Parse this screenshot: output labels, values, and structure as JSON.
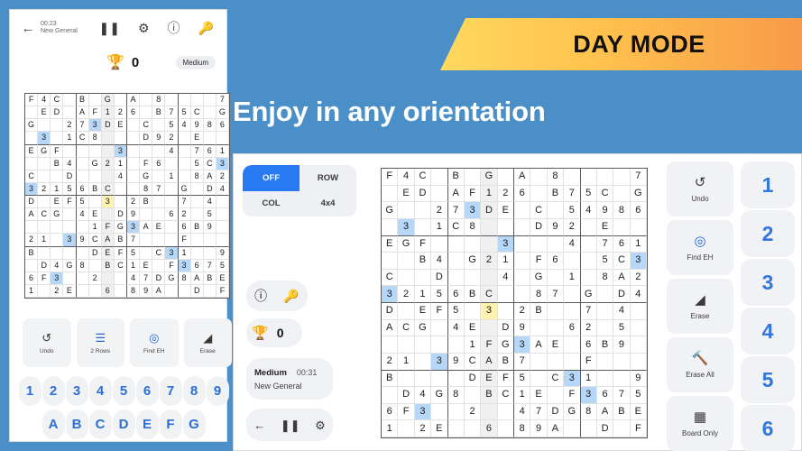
{
  "banner": {
    "label": "DAY MODE"
  },
  "headline": {
    "text": "Enjoy in any orientation"
  },
  "phone": {
    "header": {
      "back_icon": "arrow-left-icon",
      "time": "00:23",
      "puzzle_name": "New General",
      "pause_icon": "pause-icon",
      "settings_icon": "gear-icon",
      "info_icon": "info-icon",
      "key_icon": "key-icon"
    },
    "score": {
      "trophy_icon": "trophy-icon",
      "points": "0",
      "difficulty": "Medium"
    },
    "actions": [
      {
        "icon": "undo-icon",
        "glyph": "↺",
        "label": "Undo",
        "accent": false
      },
      {
        "icon": "rows-icon",
        "glyph": "☰",
        "label": "2 Rows",
        "accent": true
      },
      {
        "icon": "find-eh-icon",
        "glyph": "◎",
        "label": "Find EH",
        "accent": true
      },
      {
        "icon": "erase-icon",
        "glyph": "◢",
        "label": "Erase",
        "accent": false
      }
    ],
    "keys_numbers": [
      "1",
      "2",
      "3",
      "4",
      "5",
      "6",
      "7",
      "8",
      "9"
    ],
    "keys_letters": [
      "A",
      "B",
      "C",
      "D",
      "E",
      "F",
      "G"
    ]
  },
  "tablet": {
    "toggle": {
      "options": [
        {
          "label": "OFF",
          "selected": true
        },
        {
          "label": "ROW",
          "selected": false
        },
        {
          "label": "COL",
          "selected": false
        },
        {
          "label": "4x4",
          "selected": false
        }
      ]
    },
    "icon_pill": [
      {
        "icon": "info-icon",
        "glyph": "ⓘ"
      },
      {
        "icon": "key-icon",
        "glyph": "🔑"
      }
    ],
    "score": {
      "trophy_icon": "trophy-icon",
      "points": "0"
    },
    "meta": {
      "difficulty": "Medium",
      "time": "00:31",
      "puzzle_name": "New General"
    },
    "nav": [
      {
        "icon": "arrow-left-icon",
        "glyph": "←"
      },
      {
        "icon": "pause-icon",
        "glyph": "❙❙"
      },
      {
        "icon": "gear-icon",
        "glyph": "⚙"
      }
    ],
    "tools": [
      {
        "icon": "undo-icon",
        "glyph": "↺",
        "label": "Undo",
        "accent": false
      },
      {
        "icon": "find-eh-icon",
        "glyph": "◎",
        "label": "Find EH",
        "accent": true
      },
      {
        "icon": "erase-icon",
        "glyph": "◢",
        "label": "Erase",
        "accent": false
      },
      {
        "icon": "erase-all-icon",
        "glyph": "🔨",
        "label": "Erase All",
        "accent": false
      },
      {
        "icon": "board-only-icon",
        "glyph": "▦",
        "label": "Board Only",
        "accent": false
      }
    ],
    "numbers": [
      "1",
      "2",
      "3",
      "4",
      "5",
      "6"
    ]
  },
  "colors": {
    "page_bg": "#4a8fc7",
    "accent_blue": "#2979f2",
    "banner_from": "#ffd85e",
    "banner_to": "#f79a4a",
    "cell_highlight": "#b6d7f7",
    "cell_selected": "#fdf2b0",
    "column_shade": "#f0f0f0"
  },
  "board": {
    "size": 16,
    "box_rows": 4,
    "box_cols": 4,
    "shaded_column": 6,
    "selected_cell": {
      "row": 8,
      "col": 6
    },
    "highlight_value": "3",
    "cells": [
      [
        "F",
        "4",
        "C",
        "",
        "B",
        "",
        "G",
        "",
        "A",
        "",
        "8",
        "",
        "",
        "",
        "",
        "7"
      ],
      [
        "",
        "E",
        "D",
        "",
        "A",
        "F",
        "1",
        "2",
        "6",
        "",
        "B",
        "7",
        "5",
        "C",
        "",
        "G"
      ],
      [
        "G",
        "",
        "",
        "2",
        "7",
        "3",
        "D",
        "E",
        "",
        "C",
        "",
        "5",
        "4",
        "9",
        "8",
        "6"
      ],
      [
        "",
        "3",
        "",
        "1",
        "C",
        "8",
        "",
        "",
        "",
        "D",
        "9",
        "2",
        "",
        "E",
        "",
        ""
      ],
      [
        "E",
        "G",
        "F",
        "",
        "",
        "",
        "",
        "3",
        "",
        "",
        "",
        "4",
        "",
        "7",
        "6",
        "1"
      ],
      [
        "",
        "",
        "B",
        "4",
        "",
        "G",
        "2",
        "1",
        "",
        "F",
        "6",
        "",
        "",
        "5",
        "C",
        "3"
      ],
      [
        "C",
        "",
        "",
        "D",
        "",
        "",
        "",
        "4",
        "",
        "G",
        "",
        "1",
        "",
        "8",
        "A",
        "2"
      ],
      [
        "3",
        "2",
        "1",
        "5",
        "6",
        "B",
        "C",
        "",
        "",
        "8",
        "7",
        "",
        "G",
        "",
        "D",
        "4"
      ],
      [
        "D",
        "",
        "E",
        "F",
        "5",
        "",
        "3",
        "",
        "2",
        "B",
        "",
        "",
        "7",
        "",
        "4",
        ""
      ],
      [
        "A",
        "C",
        "G",
        "",
        "4",
        "E",
        "",
        "D",
        "9",
        "",
        "",
        "6",
        "2",
        "",
        "5",
        ""
      ],
      [
        "",
        "",
        "",
        "",
        "",
        "1",
        "F",
        "G",
        "3",
        "A",
        "E",
        "",
        "6",
        "B",
        "9",
        ""
      ],
      [
        "2",
        "1",
        "",
        "3",
        "9",
        "C",
        "A",
        "B",
        "7",
        "",
        "",
        "",
        "F",
        "",
        "",
        ""
      ],
      [
        "B",
        "",
        "",
        "",
        "",
        "D",
        "E",
        "F",
        "5",
        "",
        "C",
        "3",
        "1",
        "",
        "",
        "9"
      ],
      [
        "",
        "D",
        "4",
        "G",
        "8",
        "",
        "B",
        "C",
        "1",
        "E",
        "",
        "F",
        "3",
        "6",
        "7",
        "5"
      ],
      [
        "6",
        "F",
        "3",
        "",
        "",
        "2",
        "",
        "",
        "4",
        "7",
        "D",
        "G",
        "8",
        "A",
        "B",
        "E"
      ],
      [
        "1",
        "",
        "2",
        "E",
        "",
        "",
        "6",
        "",
        "8",
        "9",
        "A",
        "",
        "",
        "D",
        "",
        "F"
      ]
    ],
    "highlighted_cells": [
      [
        3,
        1
      ],
      [
        2,
        5
      ],
      [
        4,
        7
      ],
      [
        5,
        15
      ],
      [
        7,
        0
      ],
      [
        8,
        6
      ],
      [
        10,
        8
      ],
      [
        11,
        3
      ],
      [
        12,
        11
      ],
      [
        13,
        12
      ],
      [
        14,
        2
      ]
    ]
  }
}
